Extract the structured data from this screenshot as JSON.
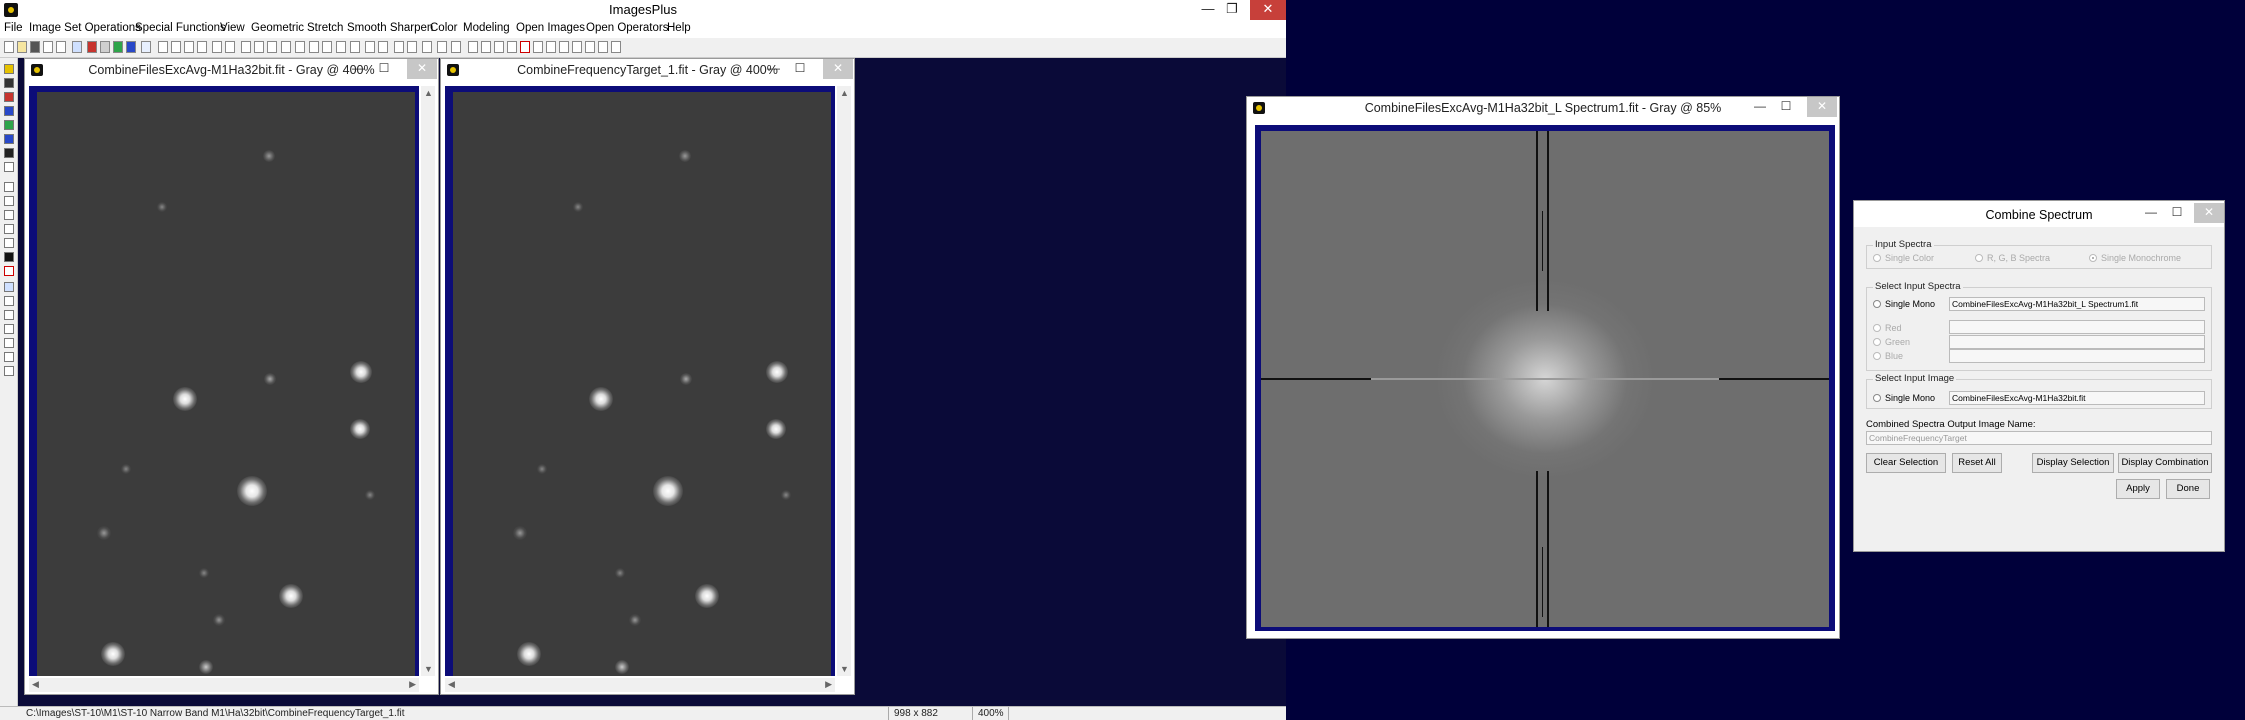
{
  "app": {
    "title": "ImagesPlus",
    "controls": {
      "minimize": "—",
      "maximize": "❐",
      "close": "✕"
    }
  },
  "menu": [
    "File",
    "Image Set Operations",
    "Special Functions",
    "View",
    "Geometric",
    "Stretch",
    "Smooth Sharpen",
    "Color",
    "Modeling",
    "Open Images",
    "Open Operators",
    "Help"
  ],
  "windows": {
    "left": {
      "title": "CombineFilesExcAvg-M1Ha32bit.fit - Gray @ 400%"
    },
    "middle": {
      "title": "CombineFrequencyTarget_1.fit - Gray @ 400%"
    },
    "spectrum": {
      "title": "CombineFilesExcAvg-M1Ha32bit_L Spectrum1.fit - Gray @ 85%"
    },
    "controls": {
      "minimize": "—",
      "maximize": "☐",
      "close": "✕"
    }
  },
  "statusbar": {
    "path": "C:\\Images\\ST-10\\M1\\ST-10 Narrow Band M1\\Ha\\32bit\\CombineFrequencyTarget_1.fit",
    "dimensions": "998 x 882",
    "zoom": "400%"
  },
  "dialog": {
    "title": "Combine Spectrum",
    "input_spectra": {
      "label": "Input Spectra",
      "options": [
        "Single Color",
        "R, G, B Spectra",
        "Single Monochrome"
      ]
    },
    "select_input_spectra": {
      "label": "Select Input Spectra",
      "single_mono_label": "Single Mono",
      "single_mono_value": "CombineFilesExcAvg-M1Ha32bit_L Spectrum1.fit",
      "red_label": "Red",
      "green_label": "Green",
      "blue_label": "Blue"
    },
    "select_input_image": {
      "label": "Select Input Image",
      "single_mono_label": "Single Mono",
      "single_mono_value": "CombineFilesExcAvg-M1Ha32bit.fit"
    },
    "output_name_label": "Combined Spectra Output Image Name:",
    "output_name_value": "CombineFrequencyTarget",
    "buttons": {
      "clear_selection": "Clear Selection",
      "reset_all": "Reset All",
      "display_selection": "Display Selection",
      "display_combination": "Display Combination",
      "apply": "Apply",
      "done": "Done"
    }
  }
}
